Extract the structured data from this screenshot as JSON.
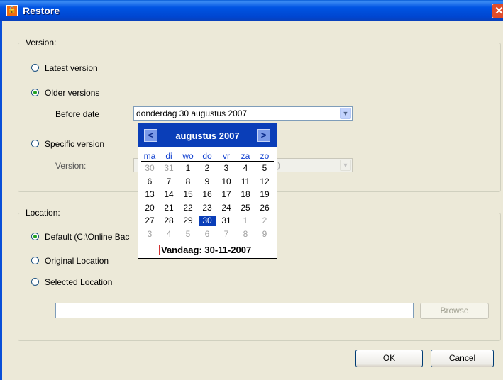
{
  "window": {
    "title": "Restore",
    "close_glyph": "✕",
    "app_icon": "lock-icon"
  },
  "version_group": {
    "legend": "Version:",
    "latest_label": "Latest version",
    "older_label": "Older versions",
    "before_date_label": "Before date",
    "before_date_value": "donderdag 30  augustus  2007",
    "specific_label": "Specific version",
    "version_label": "Version:",
    "version_value": ")",
    "selected_option": "older"
  },
  "calendar": {
    "month_title": "augustus 2007",
    "prev_glyph": "<",
    "next_glyph": ">",
    "weekdays": [
      "ma",
      "di",
      "wo",
      "do",
      "vr",
      "za",
      "zo"
    ],
    "weeks": [
      [
        {
          "d": "30",
          "o": true
        },
        {
          "d": "31",
          "o": true
        },
        {
          "d": "1"
        },
        {
          "d": "2"
        },
        {
          "d": "3"
        },
        {
          "d": "4"
        },
        {
          "d": "5"
        }
      ],
      [
        {
          "d": "6"
        },
        {
          "d": "7"
        },
        {
          "d": "8"
        },
        {
          "d": "9"
        },
        {
          "d": "10"
        },
        {
          "d": "11"
        },
        {
          "d": "12"
        }
      ],
      [
        {
          "d": "13"
        },
        {
          "d": "14"
        },
        {
          "d": "15"
        },
        {
          "d": "16"
        },
        {
          "d": "17"
        },
        {
          "d": "18"
        },
        {
          "d": "19"
        }
      ],
      [
        {
          "d": "20"
        },
        {
          "d": "21"
        },
        {
          "d": "22"
        },
        {
          "d": "23"
        },
        {
          "d": "24"
        },
        {
          "d": "25"
        },
        {
          "d": "26"
        }
      ],
      [
        {
          "d": "27"
        },
        {
          "d": "28"
        },
        {
          "d": "29"
        },
        {
          "d": "30",
          "s": true
        },
        {
          "d": "31"
        },
        {
          "d": "1",
          "o": true
        },
        {
          "d": "2",
          "o": true
        }
      ],
      [
        {
          "d": "3",
          "o": true
        },
        {
          "d": "4",
          "o": true
        },
        {
          "d": "5",
          "o": true
        },
        {
          "d": "6",
          "o": true
        },
        {
          "d": "7",
          "o": true
        },
        {
          "d": "8",
          "o": true
        },
        {
          "d": "9",
          "o": true
        }
      ]
    ],
    "today_label": "Vandaag: 30-11-2007",
    "selected_color": "#0a3eb8",
    "header_color": "#0a3eb8"
  },
  "location_group": {
    "legend": "Location:",
    "default_label": "Default (C:\\Online Bac",
    "original_label": "Original Location",
    "selected_label": "Selected Location",
    "path_value": "",
    "browse_label": "Browse",
    "selected_option": "default"
  },
  "buttons": {
    "ok_label": "OK",
    "cancel_label": "Cancel"
  }
}
